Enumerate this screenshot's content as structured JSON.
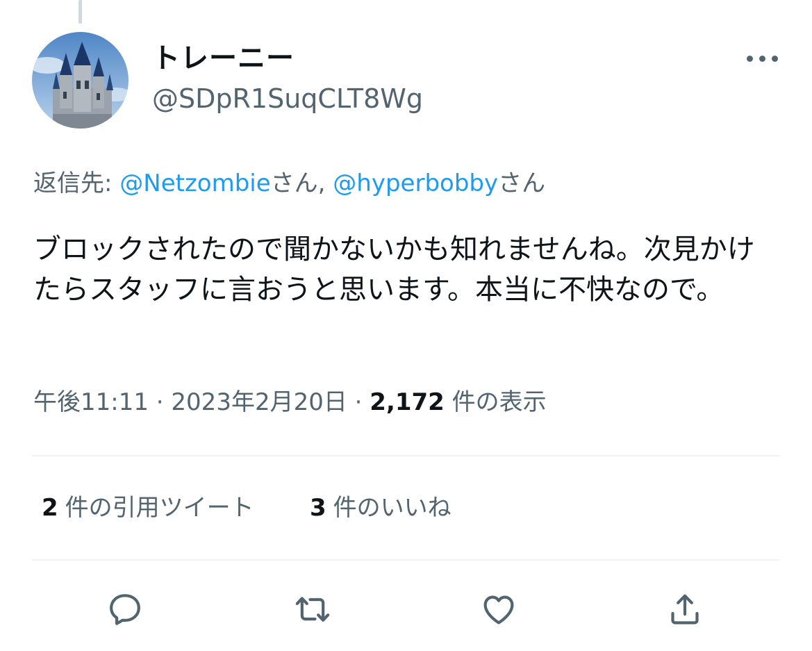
{
  "author": {
    "display_name": "トレーニー",
    "handle": "@SDpR1SuqCLT8Wg"
  },
  "reply": {
    "prefix": "返信先: ",
    "mentions": [
      {
        "handle": "@Netzombie",
        "suffix": "さん, "
      },
      {
        "handle": "@hyperbobby",
        "suffix": "さん"
      }
    ]
  },
  "tweet": {
    "text": "ブロックされたので聞かないかも知れませんね。次見かけたらスタッフに言おうと思います。本当に不快なので。"
  },
  "meta": {
    "time": "午後11:11",
    "separator": " · ",
    "date": "2023年2月20日",
    "views_count": "2,172",
    "views_label": " 件の表示"
  },
  "stats": {
    "quotes_count": "2",
    "quotes_label": "件の引用ツイート",
    "likes_count": "3",
    "likes_label": "件のいいね"
  },
  "actions": {
    "icons": [
      "reply-icon",
      "retweet-icon",
      "like-icon",
      "share-icon"
    ]
  },
  "colors": {
    "link": "#1d9bf0",
    "secondary_text": "#536471",
    "divider": "#eff3f4"
  }
}
